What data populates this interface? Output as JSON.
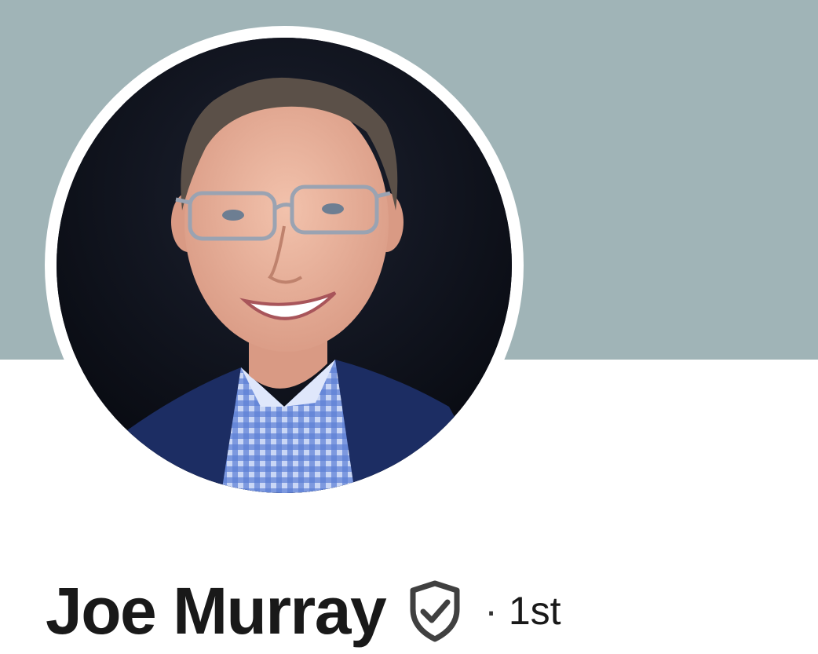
{
  "profile": {
    "name": "Joe Murray",
    "separator": "·",
    "connection_degree": "1st",
    "verified_icon": "verified-shield-check-icon",
    "avatar": "profile-photo"
  },
  "colors": {
    "banner": "#a0b4b7",
    "name_text": "#191919",
    "icon": "#404040",
    "avatar_ring": "#ffffff"
  }
}
